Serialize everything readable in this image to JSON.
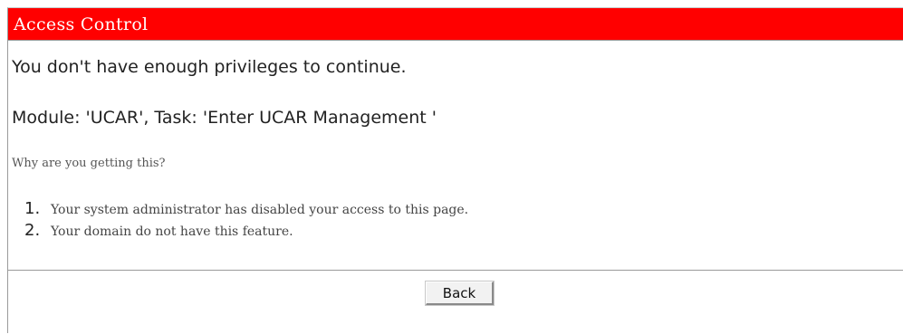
{
  "header": {
    "title": "Access Control"
  },
  "message": {
    "line1": "You don't have enough privileges to continue.",
    "line2": "Module: 'UCAR', Task: 'Enter UCAR Management '"
  },
  "why": {
    "question": "Why are you getting this?",
    "reasons": [
      {
        "number": "1.",
        "text": "Your system administrator has disabled your access to this page."
      },
      {
        "number": "2.",
        "text": "Your domain do not have this feature."
      }
    ]
  },
  "actions": {
    "back_label": "Back"
  },
  "colors": {
    "header_bg": "#ff0000",
    "header_text": "#ffffff"
  }
}
